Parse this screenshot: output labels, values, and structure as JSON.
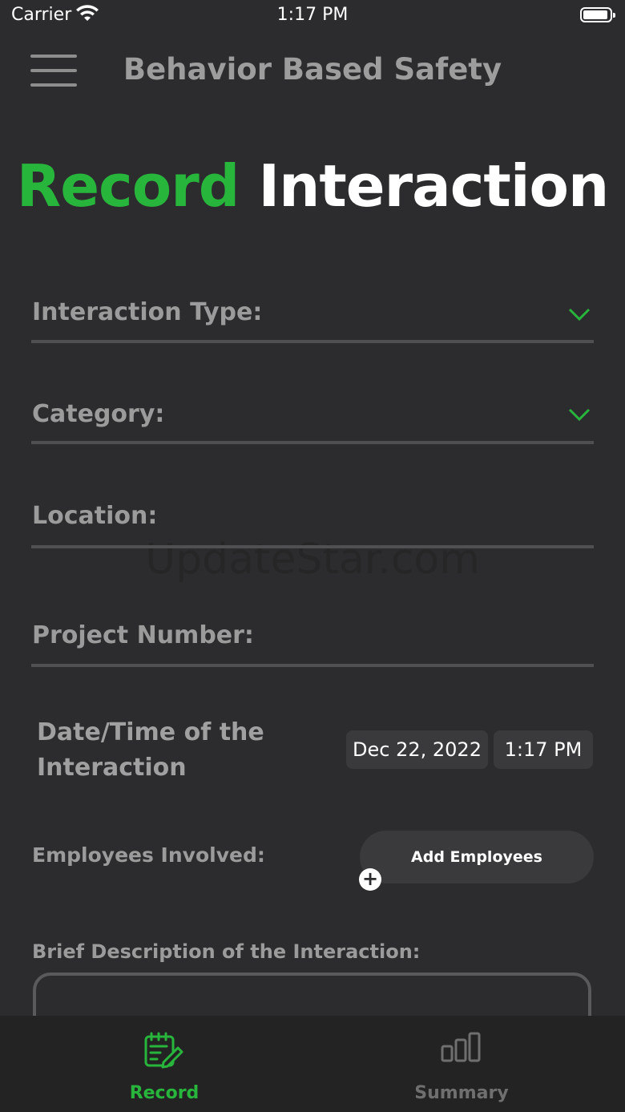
{
  "status_bar": {
    "carrier": "Carrier",
    "time": "1:17 PM",
    "icons": [
      "wifi-icon",
      "battery-icon"
    ]
  },
  "header": {
    "title": "Behavior Based Safety",
    "menu_icon": "hamburger-menu-icon"
  },
  "page": {
    "heading_accent": "Record",
    "heading_rest": "Interaction"
  },
  "form": {
    "interaction_type_label": "Interaction Type:",
    "category_label": "Category:",
    "location_label": "Location:",
    "project_number_label": "Project Number:",
    "datetime_label": "Date/Time of the Interaction",
    "date_value": "Dec 22, 2022",
    "time_value": "1:17 PM",
    "employees_label": "Employees Involved:",
    "add_employees_label": "Add Employees",
    "add_icon_glyph": "+",
    "description_label": "Brief Description of the Interaction:"
  },
  "watermark": "UpdateStar.com",
  "tab_bar": {
    "tabs": [
      {
        "label": "Record",
        "icon": "record-edit-icon",
        "active": true
      },
      {
        "label": "Summary",
        "icon": "bar-chart-icon",
        "active": false
      }
    ]
  },
  "colors": {
    "background": "#2c2c2e",
    "accent": "#28b53c",
    "tab_bar": "#232323",
    "pill": "#3a3a3c"
  }
}
